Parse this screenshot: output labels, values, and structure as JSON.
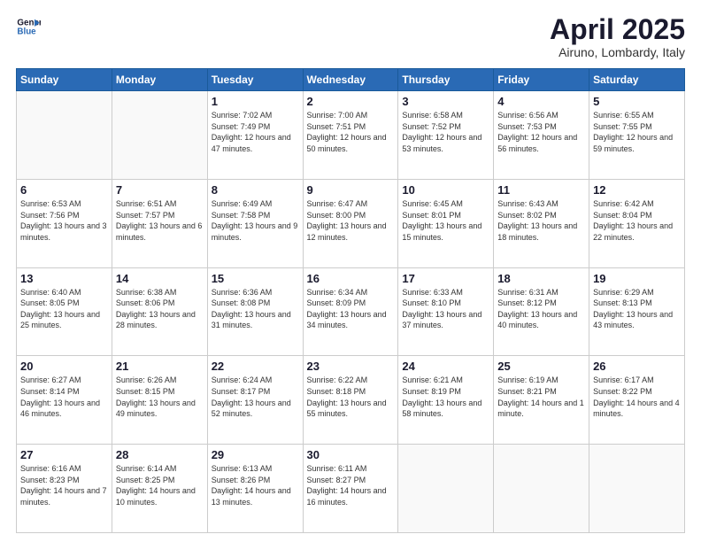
{
  "header": {
    "logo_line1": "General",
    "logo_line2": "Blue",
    "title": "April 2025",
    "subtitle": "Airuno, Lombardy, Italy"
  },
  "weekdays": [
    "Sunday",
    "Monday",
    "Tuesday",
    "Wednesday",
    "Thursday",
    "Friday",
    "Saturday"
  ],
  "weeks": [
    [
      {
        "day": "",
        "info": ""
      },
      {
        "day": "",
        "info": ""
      },
      {
        "day": "1",
        "info": "Sunrise: 7:02 AM\nSunset: 7:49 PM\nDaylight: 12 hours\nand 47 minutes."
      },
      {
        "day": "2",
        "info": "Sunrise: 7:00 AM\nSunset: 7:51 PM\nDaylight: 12 hours\nand 50 minutes."
      },
      {
        "day": "3",
        "info": "Sunrise: 6:58 AM\nSunset: 7:52 PM\nDaylight: 12 hours\nand 53 minutes."
      },
      {
        "day": "4",
        "info": "Sunrise: 6:56 AM\nSunset: 7:53 PM\nDaylight: 12 hours\nand 56 minutes."
      },
      {
        "day": "5",
        "info": "Sunrise: 6:55 AM\nSunset: 7:55 PM\nDaylight: 12 hours\nand 59 minutes."
      }
    ],
    [
      {
        "day": "6",
        "info": "Sunrise: 6:53 AM\nSunset: 7:56 PM\nDaylight: 13 hours\nand 3 minutes."
      },
      {
        "day": "7",
        "info": "Sunrise: 6:51 AM\nSunset: 7:57 PM\nDaylight: 13 hours\nand 6 minutes."
      },
      {
        "day": "8",
        "info": "Sunrise: 6:49 AM\nSunset: 7:58 PM\nDaylight: 13 hours\nand 9 minutes."
      },
      {
        "day": "9",
        "info": "Sunrise: 6:47 AM\nSunset: 8:00 PM\nDaylight: 13 hours\nand 12 minutes."
      },
      {
        "day": "10",
        "info": "Sunrise: 6:45 AM\nSunset: 8:01 PM\nDaylight: 13 hours\nand 15 minutes."
      },
      {
        "day": "11",
        "info": "Sunrise: 6:43 AM\nSunset: 8:02 PM\nDaylight: 13 hours\nand 18 minutes."
      },
      {
        "day": "12",
        "info": "Sunrise: 6:42 AM\nSunset: 8:04 PM\nDaylight: 13 hours\nand 22 minutes."
      }
    ],
    [
      {
        "day": "13",
        "info": "Sunrise: 6:40 AM\nSunset: 8:05 PM\nDaylight: 13 hours\nand 25 minutes."
      },
      {
        "day": "14",
        "info": "Sunrise: 6:38 AM\nSunset: 8:06 PM\nDaylight: 13 hours\nand 28 minutes."
      },
      {
        "day": "15",
        "info": "Sunrise: 6:36 AM\nSunset: 8:08 PM\nDaylight: 13 hours\nand 31 minutes."
      },
      {
        "day": "16",
        "info": "Sunrise: 6:34 AM\nSunset: 8:09 PM\nDaylight: 13 hours\nand 34 minutes."
      },
      {
        "day": "17",
        "info": "Sunrise: 6:33 AM\nSunset: 8:10 PM\nDaylight: 13 hours\nand 37 minutes."
      },
      {
        "day": "18",
        "info": "Sunrise: 6:31 AM\nSunset: 8:12 PM\nDaylight: 13 hours\nand 40 minutes."
      },
      {
        "day": "19",
        "info": "Sunrise: 6:29 AM\nSunset: 8:13 PM\nDaylight: 13 hours\nand 43 minutes."
      }
    ],
    [
      {
        "day": "20",
        "info": "Sunrise: 6:27 AM\nSunset: 8:14 PM\nDaylight: 13 hours\nand 46 minutes."
      },
      {
        "day": "21",
        "info": "Sunrise: 6:26 AM\nSunset: 8:15 PM\nDaylight: 13 hours\nand 49 minutes."
      },
      {
        "day": "22",
        "info": "Sunrise: 6:24 AM\nSunset: 8:17 PM\nDaylight: 13 hours\nand 52 minutes."
      },
      {
        "day": "23",
        "info": "Sunrise: 6:22 AM\nSunset: 8:18 PM\nDaylight: 13 hours\nand 55 minutes."
      },
      {
        "day": "24",
        "info": "Sunrise: 6:21 AM\nSunset: 8:19 PM\nDaylight: 13 hours\nand 58 minutes."
      },
      {
        "day": "25",
        "info": "Sunrise: 6:19 AM\nSunset: 8:21 PM\nDaylight: 14 hours\nand 1 minute."
      },
      {
        "day": "26",
        "info": "Sunrise: 6:17 AM\nSunset: 8:22 PM\nDaylight: 14 hours\nand 4 minutes."
      }
    ],
    [
      {
        "day": "27",
        "info": "Sunrise: 6:16 AM\nSunset: 8:23 PM\nDaylight: 14 hours\nand 7 minutes."
      },
      {
        "day": "28",
        "info": "Sunrise: 6:14 AM\nSunset: 8:25 PM\nDaylight: 14 hours\nand 10 minutes."
      },
      {
        "day": "29",
        "info": "Sunrise: 6:13 AM\nSunset: 8:26 PM\nDaylight: 14 hours\nand 13 minutes."
      },
      {
        "day": "30",
        "info": "Sunrise: 6:11 AM\nSunset: 8:27 PM\nDaylight: 14 hours\nand 16 minutes."
      },
      {
        "day": "",
        "info": ""
      },
      {
        "day": "",
        "info": ""
      },
      {
        "day": "",
        "info": ""
      }
    ]
  ]
}
